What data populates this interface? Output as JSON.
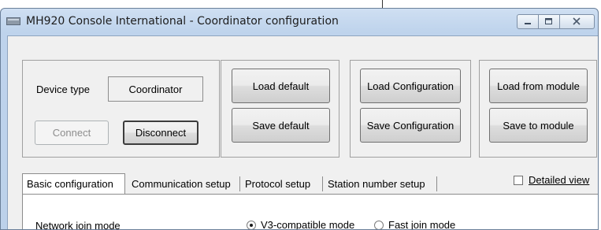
{
  "window": {
    "title": "MH920 Console International - Coordinator configuration",
    "icon": "app-icon",
    "minimize_icon": "minimize-icon",
    "maximize_icon": "maximize-icon",
    "close_icon": "close-icon"
  },
  "device": {
    "type_label": "Device type",
    "type_value": "Coordinator",
    "connect_label": "Connect",
    "connect_enabled": false,
    "disconnect_label": "Disconnect"
  },
  "defaults": {
    "load_label": "Load default",
    "save_label": "Save default"
  },
  "configuration": {
    "load_label": "Load Configuration",
    "save_label": "Save Configuration"
  },
  "module": {
    "load_label": "Load from module",
    "save_label": "Save to module"
  },
  "tabs": [
    {
      "label": "Basic configuration",
      "active": true
    },
    {
      "label": "Communication setup",
      "active": false
    },
    {
      "label": "Protocol setup",
      "active": false
    },
    {
      "label": "Station number setup",
      "active": false
    }
  ],
  "detailed_view": {
    "label": "Detailed view",
    "checked": false
  },
  "basic": {
    "network_join_label": "Network join mode",
    "options": [
      {
        "label": "V3-compatible mode",
        "selected": true
      },
      {
        "label": "Fast join mode",
        "selected": false
      }
    ]
  }
}
